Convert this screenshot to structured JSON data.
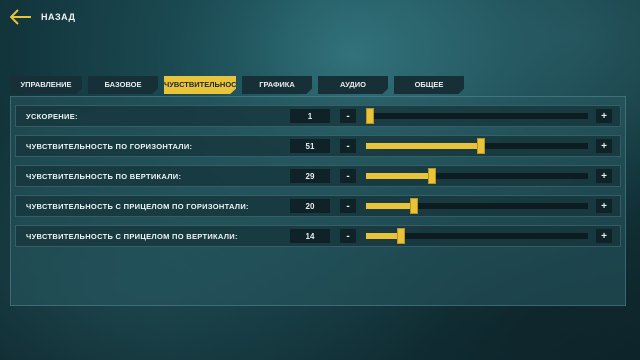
{
  "header": {
    "back_label": "НАЗАД"
  },
  "tabs": [
    {
      "label": "УПРАВЛЕНИЕ",
      "active": false
    },
    {
      "label": "БАЗОВОЕ",
      "active": false
    },
    {
      "label": "ЧУВСТВИТЕЛЬНОСТЬ",
      "active": true
    },
    {
      "label": "ГРАФИКА",
      "active": false
    },
    {
      "label": "АУДИО",
      "active": false
    },
    {
      "label": "ОБЩЕЕ",
      "active": false
    }
  ],
  "settings": [
    {
      "label": "УСКОРЕНИЕ:",
      "value": "1",
      "level": 0.0
    },
    {
      "label": "ЧУВСТВИТЕЛЬНОСТЬ ПО ГОРИЗОНТАЛИ:",
      "value": "51",
      "level": 0.5
    },
    {
      "label": "ЧУВСТВИТЕЛЬНОСТЬ ПО ВЕРТИКАЛИ:",
      "value": "29",
      "level": 0.28
    },
    {
      "label": "ЧУВСТВИТЕЛЬНОСТЬ С ПРИЦЕЛОМ ПО ГОРИЗОНТАЛИ:",
      "value": "20",
      "level": 0.2
    },
    {
      "label": "ЧУВСТВИТЕЛЬНОСТЬ С ПРИЦЕЛОМ ПО ВЕРТИКАЛИ:",
      "value": "14",
      "level": 0.14
    }
  ],
  "controls": {
    "minus": "-",
    "plus": "+"
  },
  "colors": {
    "accent": "#e9c43a",
    "panel": "#285a62",
    "row": "#16343a"
  },
  "icons": {
    "back": "arrow-left-icon"
  }
}
